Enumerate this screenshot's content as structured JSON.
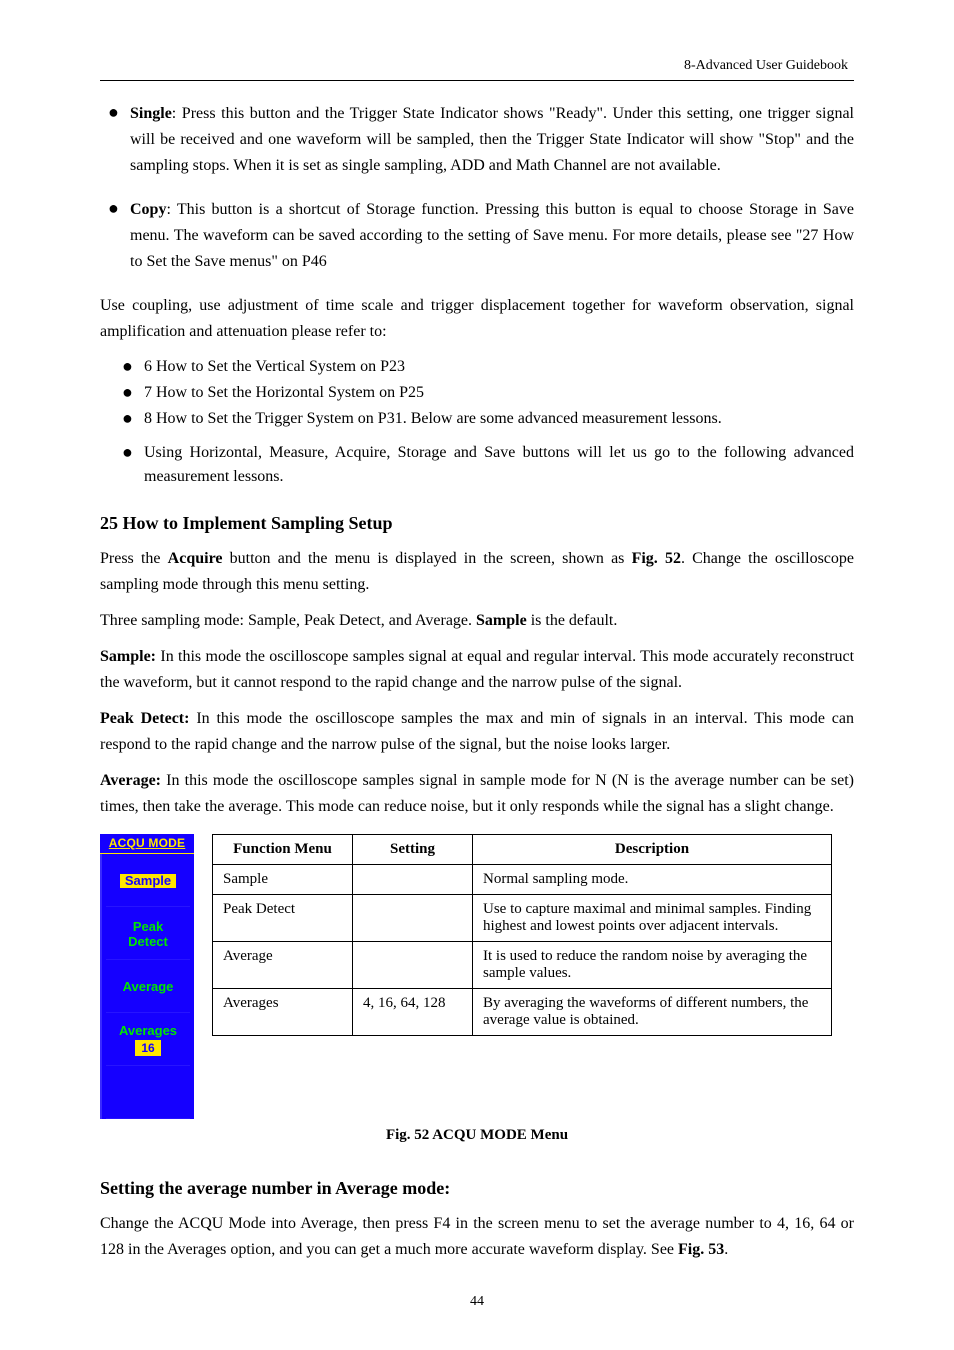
{
  "header": {
    "text": "8-Advanced User Guidebook"
  },
  "top_bullets": [
    {
      "strong": "Single",
      "rest": ": Press this button and the Trigger State Indicator shows \"Ready\". Under this setting, one trigger signal will be received and one waveform will be sampled, then the Trigger State Indicator will show \"Stop\" and the sampling stops. When it is set as single sampling, ADD and Math Channel are not available.",
      "pre": ""
    },
    {
      "strong": "Copy",
      "rest": ": This button is a shortcut of Storage function. Pressing this button is equal to choose Storage in Save menu. The waveform can be saved according to the setting of Save menu. For more details, please see \"27 How to Set the Save menus\" on P46",
      "pre": ""
    }
  ],
  "short_list_intro": "Use coupling, use adjustment of time scale and trigger displacement together for waveform observation, signal amplification and attenuation please refer to:",
  "short_bullets": [
    "6 How to Set the Vertical System on P23",
    "7 How to Set the Horizontal System on P25",
    "8 How to Set the Trigger System on P31. Below are some advanced measurement lessons.",
    "Using Horizontal, Measure, Acquire, Storage and Save buttons will let us go to the following advanced measurement lessons."
  ],
  "h2_main": "25 How to Implement Sampling Setup",
  "para1_a": "Press the ",
  "para1_b": "Acquire",
  "para1_c": " button and the menu is displayed in the screen, shown as ",
  "para1_d": "Fig. 52",
  "para1_e": ". Change the oscilloscope sampling mode through this menu setting.",
  "para2_a": "Three sampling mode: Sample, Peak Detect, and Average. ",
  "para2_b": "Sample",
  "para2_c": " is the default.",
  "para3_a": "Sample: ",
  "para3_b": "In this mode the oscilloscope samples signal at equal and regular interval. This mode accurately reconstruct the waveform, but it cannot respond to the rapid change and the narrow pulse of the signal.",
  "para4_a": "Peak Detect: ",
  "para4_b": "In this mode the oscilloscope samples the max and min of signals in an interval. This mode can respond to the rapid change and the narrow pulse of the signal, but the noise looks larger.",
  "para5_a": "Average: ",
  "para5_b": "In this mode the oscilloscope samples signal in sample mode for N (N is the average number can be set) times, then take the average. This mode can reduce noise, but it only responds while the signal has a slight change.",
  "menu_panel": {
    "title": "ACQU MODE",
    "items": {
      "sample": "Sample",
      "peak1": "Peak",
      "peak2": "Detect",
      "average": "Average",
      "averages_label": "Averages",
      "averages_value": "16"
    }
  },
  "table": {
    "headers": [
      "Function Menu",
      "Setting",
      "Description"
    ],
    "rows": [
      {
        "fm": "Sample",
        "setting": "",
        "desc": "Normal sampling mode."
      },
      {
        "fm": "Peak Detect",
        "setting": "",
        "desc": "Use to capture maximal and minimal samples. Finding highest and lowest points over adjacent intervals."
      },
      {
        "fm": "Average",
        "setting": "",
        "desc": "It is used to reduce the random noise by averaging the sample values."
      },
      {
        "fm": "Averages",
        "setting": "4, 16, 64, 128",
        "desc": "By averaging the waveforms of different numbers, the average value is obtained."
      }
    ]
  },
  "caption": "Fig. 52 ACQU MODE Menu",
  "h2_sub": "Setting the average number in Average mode:",
  "para_sub_a": "Change the ACQU Mode into Average, then press F4 in the screen menu to set the average number to 4, 16, 64 or 128 in the Averages option, and you can get a much more accurate waveform display. See ",
  "para_sub_b": "Fig. 53",
  "para_sub_c": ".",
  "page_number": "44"
}
